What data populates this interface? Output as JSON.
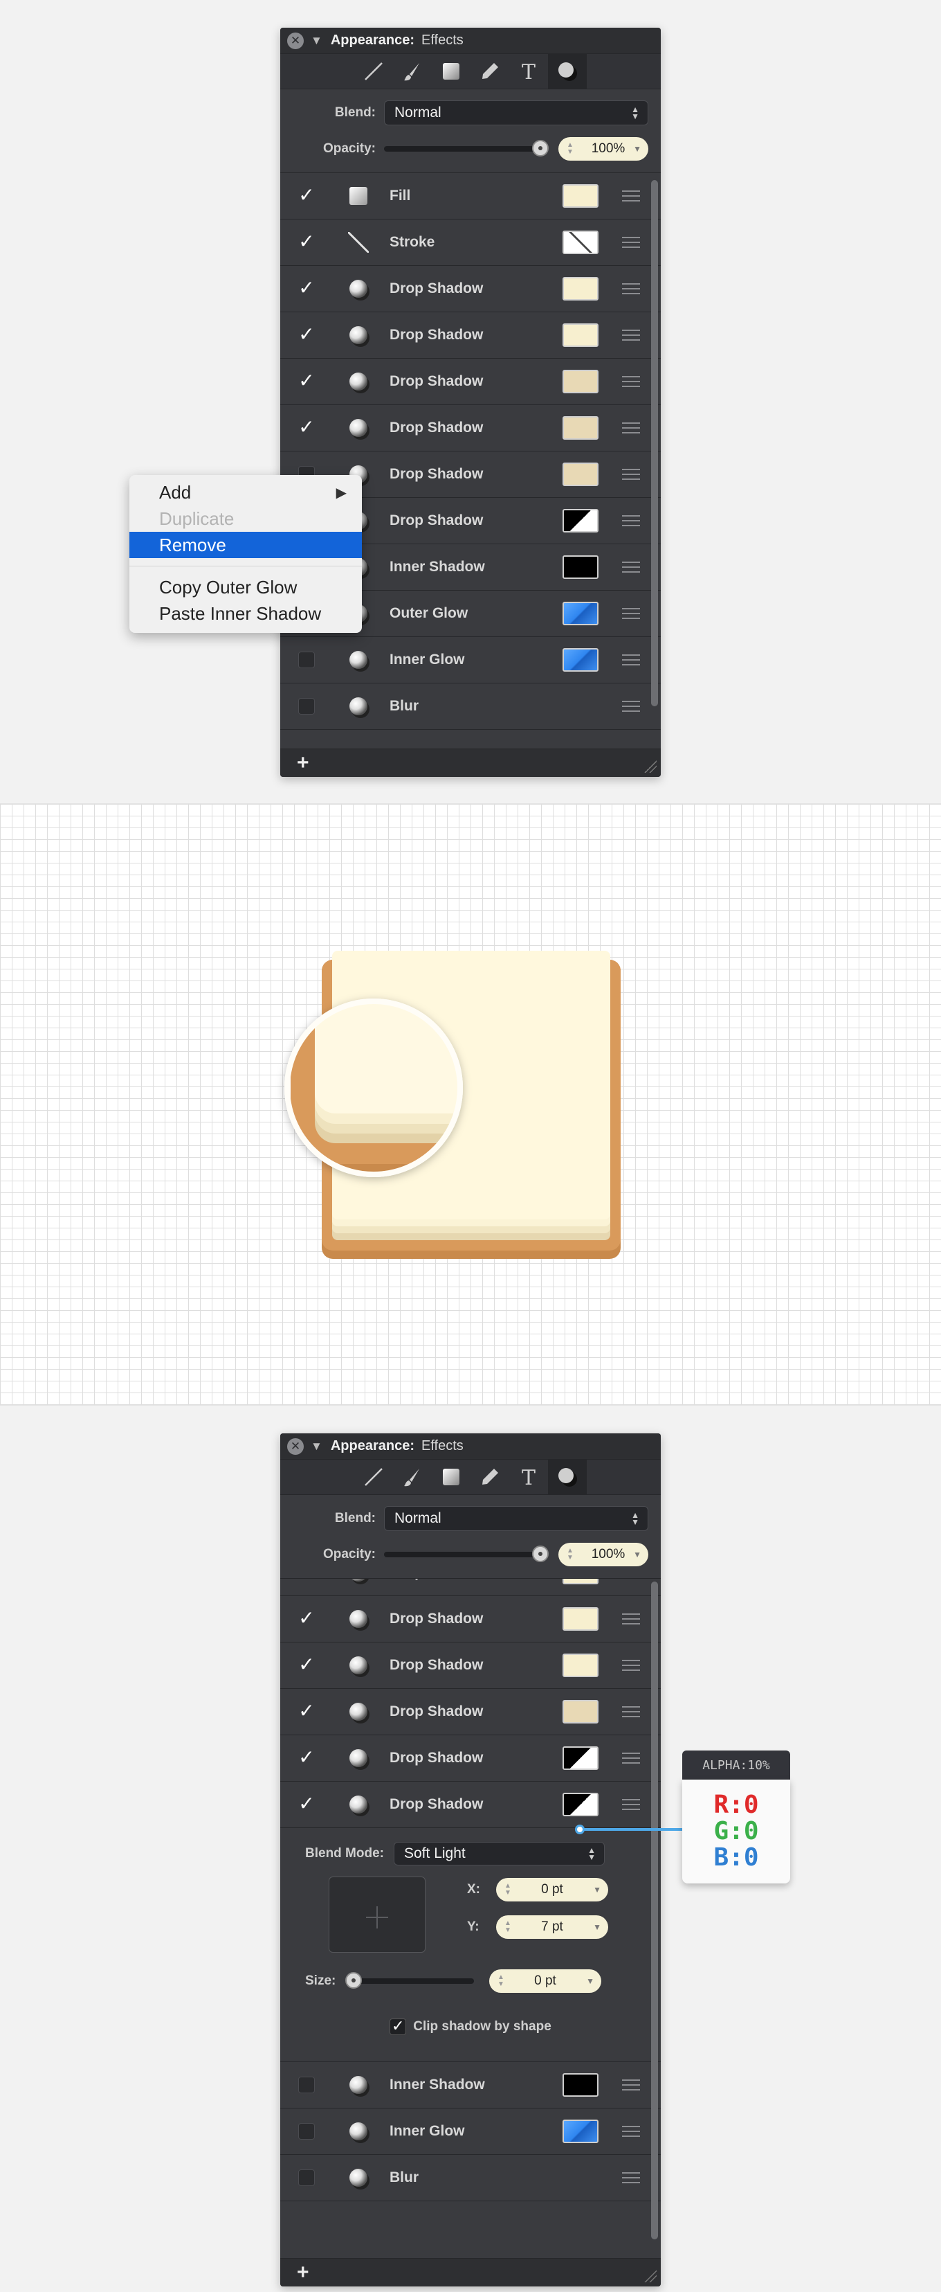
{
  "colors": {
    "panel_bg": "#3a3b3f",
    "highlight": "#1364d9",
    "cream": "#f7efcf",
    "cream_light": "#fff8dd",
    "tan": "#e8d9b5",
    "orange": "#d99a5b",
    "blue": "#2f86f0",
    "pill": "#f5f1d7"
  },
  "panel": {
    "title": "Appearance:",
    "subtitle": "Effects",
    "close_icon": "close-icon",
    "toolbar": [
      "line-tool-icon",
      "brush-tool-icon",
      "fill-tool-icon",
      "pen-tool-icon",
      "text-tool-icon",
      "effects-tool-icon"
    ],
    "blend_label": "Blend:",
    "blend_value": "Normal",
    "opacity_label": "Opacity:",
    "opacity_value": "100%",
    "opacity_fraction": 1.0
  },
  "top_rows": [
    {
      "checked": true,
      "icon": "fill",
      "label": "Fill",
      "swatch": "cream"
    },
    {
      "checked": true,
      "icon": "stroke",
      "label": "Stroke",
      "swatch": "slash"
    },
    {
      "checked": true,
      "icon": "effect",
      "label": "Drop Shadow",
      "swatch": "cream"
    },
    {
      "checked": true,
      "icon": "effect",
      "label": "Drop Shadow",
      "swatch": "cream"
    },
    {
      "checked": true,
      "icon": "effect",
      "label": "Drop Shadow",
      "swatch": "tan"
    },
    {
      "checked": true,
      "icon": "effect",
      "label": "Drop Shadow",
      "swatch": "tan"
    },
    {
      "checked": false,
      "icon": "effect",
      "label": "Drop Shadow",
      "swatch": "tan"
    },
    {
      "checked": false,
      "icon": "effect",
      "label": "Drop Shadow",
      "swatch": "blackwhite"
    },
    {
      "checked": false,
      "icon": "effect",
      "label": "Inner Shadow",
      "swatch": "black"
    },
    {
      "checked": false,
      "icon": "effect",
      "label": "Outer Glow",
      "swatch": "blue"
    },
    {
      "checked": false,
      "icon": "effect",
      "label": "Inner Glow",
      "swatch": "blue"
    },
    {
      "checked": false,
      "icon": "effect",
      "label": "Blur",
      "swatch": "none"
    }
  ],
  "context_menu": {
    "add": "Add",
    "duplicate": "Duplicate",
    "remove": "Remove",
    "copy": "Copy Outer Glow",
    "paste": "Paste Inner Shadow",
    "submenu_icon": "submenu-arrow-icon"
  },
  "bottom_rows_top": [
    {
      "checked": true,
      "label": "Drop Shadow",
      "swatch": "cream"
    },
    {
      "checked": true,
      "label": "Drop Shadow",
      "swatch": "cream"
    },
    {
      "checked": true,
      "label": "Drop Shadow",
      "swatch": "cream"
    },
    {
      "checked": true,
      "label": "Drop Shadow",
      "swatch": "tan"
    },
    {
      "checked": true,
      "label": "Drop Shadow",
      "swatch": "blackwhite"
    },
    {
      "checked": true,
      "label": "Drop Shadow",
      "swatch": "blackwhite"
    }
  ],
  "inspector": {
    "blend_mode_label": "Blend Mode:",
    "blend_mode_value": "Soft Light",
    "x_label": "X:",
    "x_value": "0 pt",
    "y_label": "Y:",
    "y_value": "7 pt",
    "size_label": "Size:",
    "size_value": "0 pt",
    "clip_label": "Clip shadow by shape",
    "clip_checked": true
  },
  "bottom_rows_after": [
    {
      "checked": false,
      "label": "Inner Shadow",
      "swatch": "black"
    },
    {
      "checked": false,
      "label": "Inner Glow",
      "swatch": "blue"
    },
    {
      "checked": false,
      "label": "Blur",
      "swatch": "none"
    }
  ],
  "tooltip": {
    "alpha": "ALPHA:10%",
    "r": "R:0",
    "g": "G:0",
    "b": "B:0"
  },
  "add_symbol": "+"
}
